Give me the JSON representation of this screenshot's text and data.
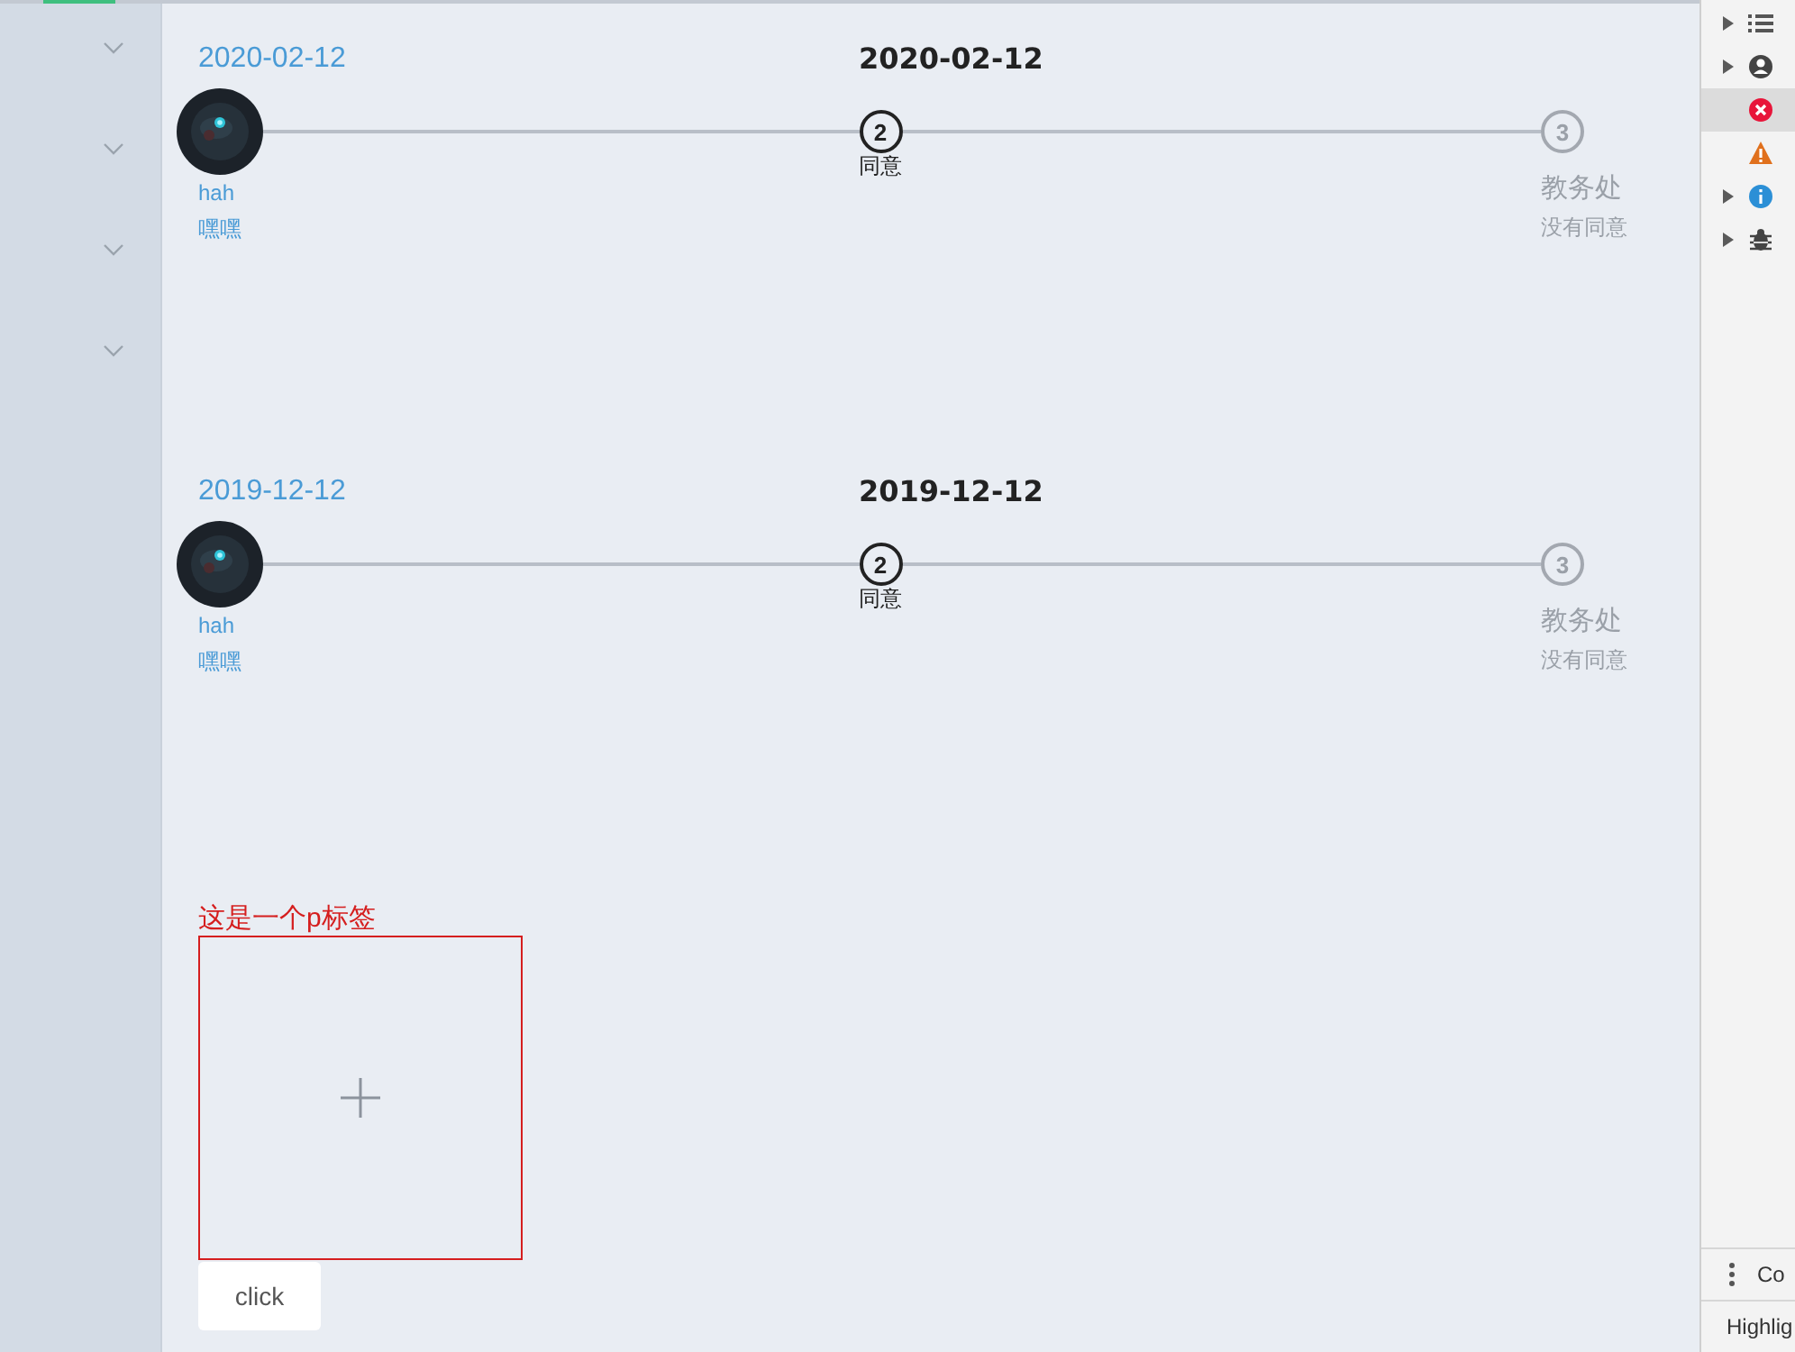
{
  "sidebar": {
    "items": [
      {
        "expanded": false
      },
      {
        "expanded": false
      },
      {
        "expanded": false
      },
      {
        "expanded": false
      }
    ]
  },
  "records": [
    {
      "steps": [
        {
          "kind": "avatar",
          "finished": true,
          "current": false,
          "heading": "2020-02-12",
          "lines": [
            "hah",
            "嘿嘿"
          ]
        },
        {
          "kind": "number",
          "finished": false,
          "current": true,
          "number": "2",
          "heading": "2020-02-12",
          "lines": [
            "同意"
          ]
        },
        {
          "kind": "number",
          "finished": false,
          "current": false,
          "number": "3",
          "title": "教务处",
          "lines": [
            "没有同意"
          ]
        }
      ]
    },
    {
      "steps": [
        {
          "kind": "avatar",
          "finished": true,
          "current": false,
          "heading": "2019-12-12",
          "lines": [
            "hah",
            "嘿嘿"
          ]
        },
        {
          "kind": "number",
          "finished": false,
          "current": true,
          "number": "2",
          "heading": "2019-12-12",
          "lines": [
            "同意"
          ]
        },
        {
          "kind": "number",
          "finished": false,
          "current": false,
          "number": "3",
          "title": "教务处",
          "lines": [
            "没有同意"
          ]
        }
      ]
    }
  ],
  "p_tag": "这是一个p标签",
  "upload": {
    "kind": "plus"
  },
  "click_button": "click",
  "devtools": {
    "items": [
      {
        "kind": "list",
        "expandable": true,
        "selected": false
      },
      {
        "kind": "user",
        "expandable": true,
        "selected": false
      },
      {
        "kind": "error",
        "expandable": false,
        "selected": true
      },
      {
        "kind": "warning",
        "expandable": false,
        "selected": false
      },
      {
        "kind": "info",
        "expandable": true,
        "selected": false
      },
      {
        "kind": "bug",
        "expandable": true,
        "selected": false
      }
    ],
    "footer": [
      {
        "kind": "menu",
        "text": "Co"
      },
      {
        "kind": "plain",
        "text": "Highlig"
      }
    ]
  }
}
